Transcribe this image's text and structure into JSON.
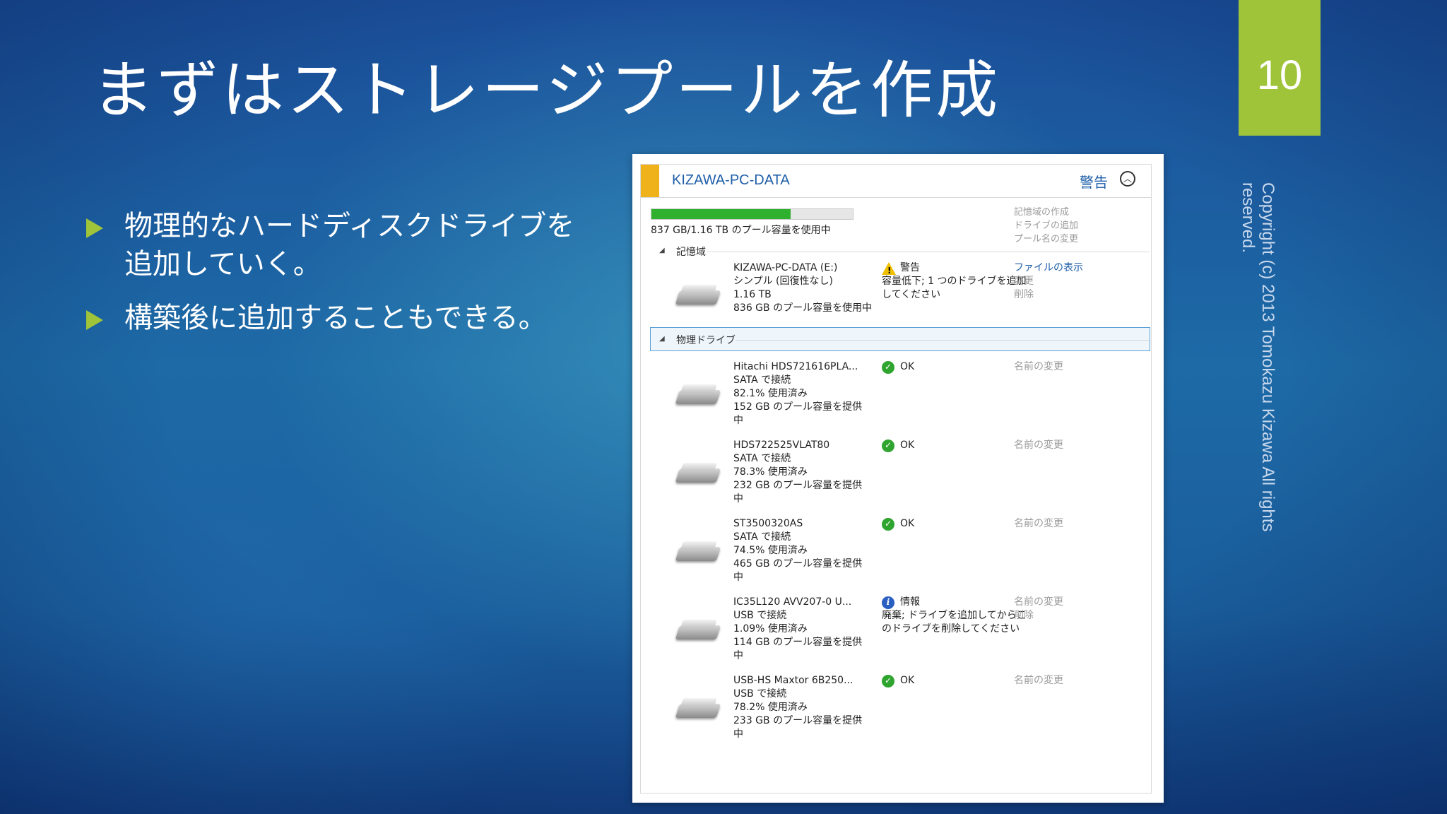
{
  "slide": {
    "title": "まずはストレージプールを作成",
    "page_number": "10",
    "copyright": "Copyright (c) 2013 Tomokazu Kizawa All rights reserved.",
    "bullets": [
      "物理的なハードディスクドライブを\n追加していく。",
      "構築後に追加することもできる。"
    ]
  },
  "pool": {
    "name": "KIZAWA-PC-DATA",
    "status_label": "警告",
    "usage_text": "837 GB/1.16 TB のプール容量を使用中",
    "usage_fraction": 0.69,
    "links": [
      "記憶域の作成",
      "ドライブの追加",
      "プール名の変更"
    ],
    "storage_section_label": "記憶域",
    "drives_section_label": "物理ドライブ",
    "storage": {
      "name": "KIZAWA-PC-DATA (E:)",
      "type": "シンプル (回復性なし)",
      "size": "1.16 TB",
      "usage": "836 GB のプール容量を使用中",
      "status_title": "警告",
      "status_detail": [
        "容量低下; 1 つのドライブを追加",
        "してください"
      ],
      "actions": [
        "ファイルの表示",
        "変更",
        "削除"
      ]
    },
    "drives": [
      {
        "name": "Hitachi HDS721616PLA...",
        "connection": "SATA で接続",
        "used": "82.1% 使用済み",
        "provides": "152 GB のプール容量を提供",
        "provides_tail": "中",
        "status": "OK",
        "status_detail": [],
        "actions": [
          "名前の変更"
        ]
      },
      {
        "name": "HDS722525VLAT80",
        "connection": "SATA で接続",
        "used": "78.3% 使用済み",
        "provides": "232 GB のプール容量を提供",
        "provides_tail": "中",
        "status": "OK",
        "status_detail": [],
        "actions": [
          "名前の変更"
        ]
      },
      {
        "name": "ST3500320AS",
        "connection": "SATA で接続",
        "used": "74.5% 使用済み",
        "provides": "465 GB のプール容量を提供",
        "provides_tail": "中",
        "status": "OK",
        "status_detail": [],
        "actions": [
          "名前の変更"
        ]
      },
      {
        "name": "IC35L120 AVV207-0 U...",
        "connection": "USB で接続",
        "used": "1.09% 使用済み",
        "provides": "114 GB のプール容量を提供",
        "provides_tail": "中",
        "status": "情報",
        "status_detail": [
          "廃棄; ドライブを追加してからこ",
          "のドライブを削除してください"
        ],
        "actions": [
          "名前の変更",
          "削除"
        ]
      },
      {
        "name": "USB-HS Maxtor 6B250...",
        "connection": "USB で接続",
        "used": "78.2% 使用済み",
        "provides": "233 GB のプール容量を提供",
        "provides_tail": "中",
        "status": "OK",
        "status_detail": [],
        "actions": [
          "名前の変更"
        ]
      }
    ]
  },
  "colors": {
    "accent_green": "#9fc43a",
    "warning_orange": "#f0b21a",
    "link_blue": "#1e5ea8",
    "ok_green": "#2fa52f"
  }
}
